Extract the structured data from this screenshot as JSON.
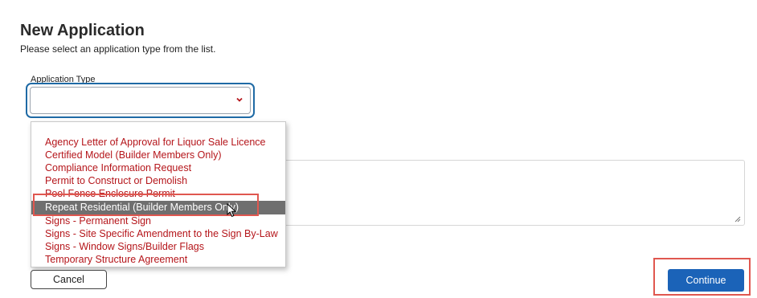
{
  "page": {
    "title": "New Application",
    "subtitle": "Please select an application type from the list."
  },
  "form": {
    "application_type_label": "Application Type",
    "application_type_value": ""
  },
  "dropdown": {
    "options": [
      {
        "label": "Agency Letter of Approval for Liquor Sale Licence",
        "selected": false
      },
      {
        "label": "Certified Model (Builder Members Only)",
        "selected": false
      },
      {
        "label": "Compliance Information Request",
        "selected": false
      },
      {
        "label": "Permit to Construct or Demolish",
        "selected": false
      },
      {
        "label": "Pool Fence Enclosure Permit",
        "selected": false
      },
      {
        "label": "Repeat Residential (Builder Members Only)",
        "selected": true
      },
      {
        "label": "Signs - Permanent Sign",
        "selected": false
      },
      {
        "label": "Signs - Site Specific Amendment to the Sign By-Law",
        "selected": false
      },
      {
        "label": "Signs - Window Signs/Builder Flags",
        "selected": false
      },
      {
        "label": "Temporary Structure Agreement",
        "selected": false
      }
    ]
  },
  "buttons": {
    "cancel": "Cancel",
    "continue": "Continue"
  },
  "colors": {
    "option_text": "#b5161b",
    "selected_bg": "#6f6f6f",
    "focus_border": "#1f6aa5",
    "primary_button": "#1b63b8",
    "annotation_red": "#e0574f"
  },
  "icons": {
    "select_arrow": "chevron-down-icon",
    "cursor": "mouse-pointer-icon",
    "textarea_grip": "resize-handle-icon"
  }
}
